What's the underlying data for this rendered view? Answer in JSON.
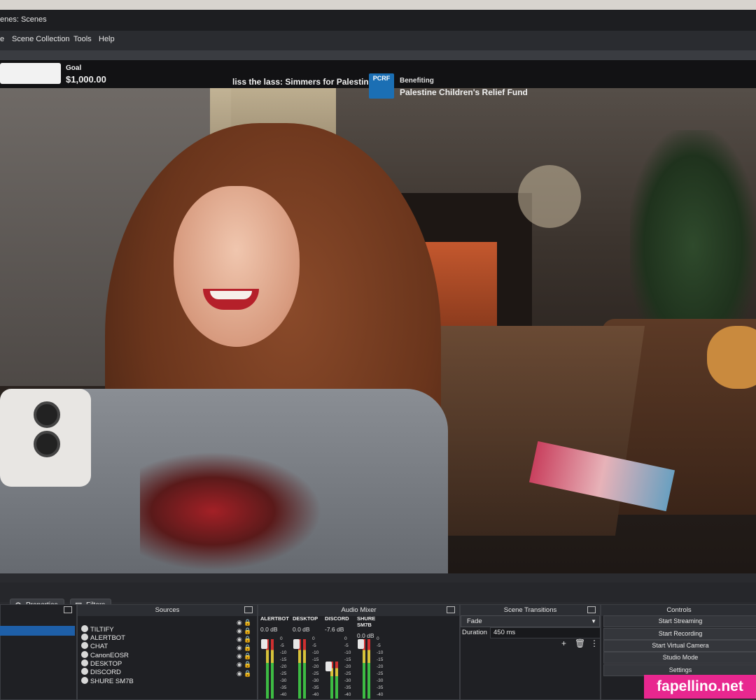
{
  "window": {
    "title": "enes: Scenes"
  },
  "menu": {
    "items": [
      "e",
      "Scene Collection",
      "Tools",
      "Help"
    ]
  },
  "overlay": {
    "goal_label": "Goal",
    "goal_value": "$1,000.00",
    "event_title": "liss the lass: Simmers for Palestine",
    "logo_text": "PCRF",
    "benefiting_label": "Benefiting",
    "benefiting_value": "Palestine Children's Relief Fund"
  },
  "toolbar": {
    "properties": "Properties",
    "filters": "Filters"
  },
  "sources": {
    "title": "Sources",
    "items": [
      "TILTIFY",
      "ALERTBOT",
      "CHAT",
      "CanonEOSR",
      "DESKTOP",
      "DISCORD",
      "SHURE SM7B"
    ]
  },
  "mixer": {
    "title": "Audio Mixer",
    "channels": [
      {
        "name": "ALERTBOT",
        "db": "0.0 dB",
        "level": 0.95
      },
      {
        "name": "DESKTOP",
        "db": "0.0 dB",
        "level": 0.95
      },
      {
        "name": "DISCORD",
        "db": "-7.6 dB",
        "level": 0.6
      },
      {
        "name": "SHURE SM7B",
        "db": "0.0 dB",
        "level": 0.95
      }
    ],
    "scale": [
      "0",
      "-5",
      "-10",
      "-15",
      "-20",
      "-25",
      "-30",
      "-35",
      "-40"
    ]
  },
  "transitions": {
    "title": "Scene Transitions",
    "selected": "Fade",
    "duration_label": "Duration",
    "duration_value": "450 ms"
  },
  "controls": {
    "title": "Controls",
    "buttons": [
      "Start Streaming",
      "Start Recording",
      "Start Virtual Camera",
      "Studio Mode",
      "Settings"
    ]
  },
  "watermark": "fapellino.net",
  "colors": {
    "accent": "#1e5fa8",
    "watermark": "#e8278f",
    "pcrf": "#1b6fb4"
  }
}
